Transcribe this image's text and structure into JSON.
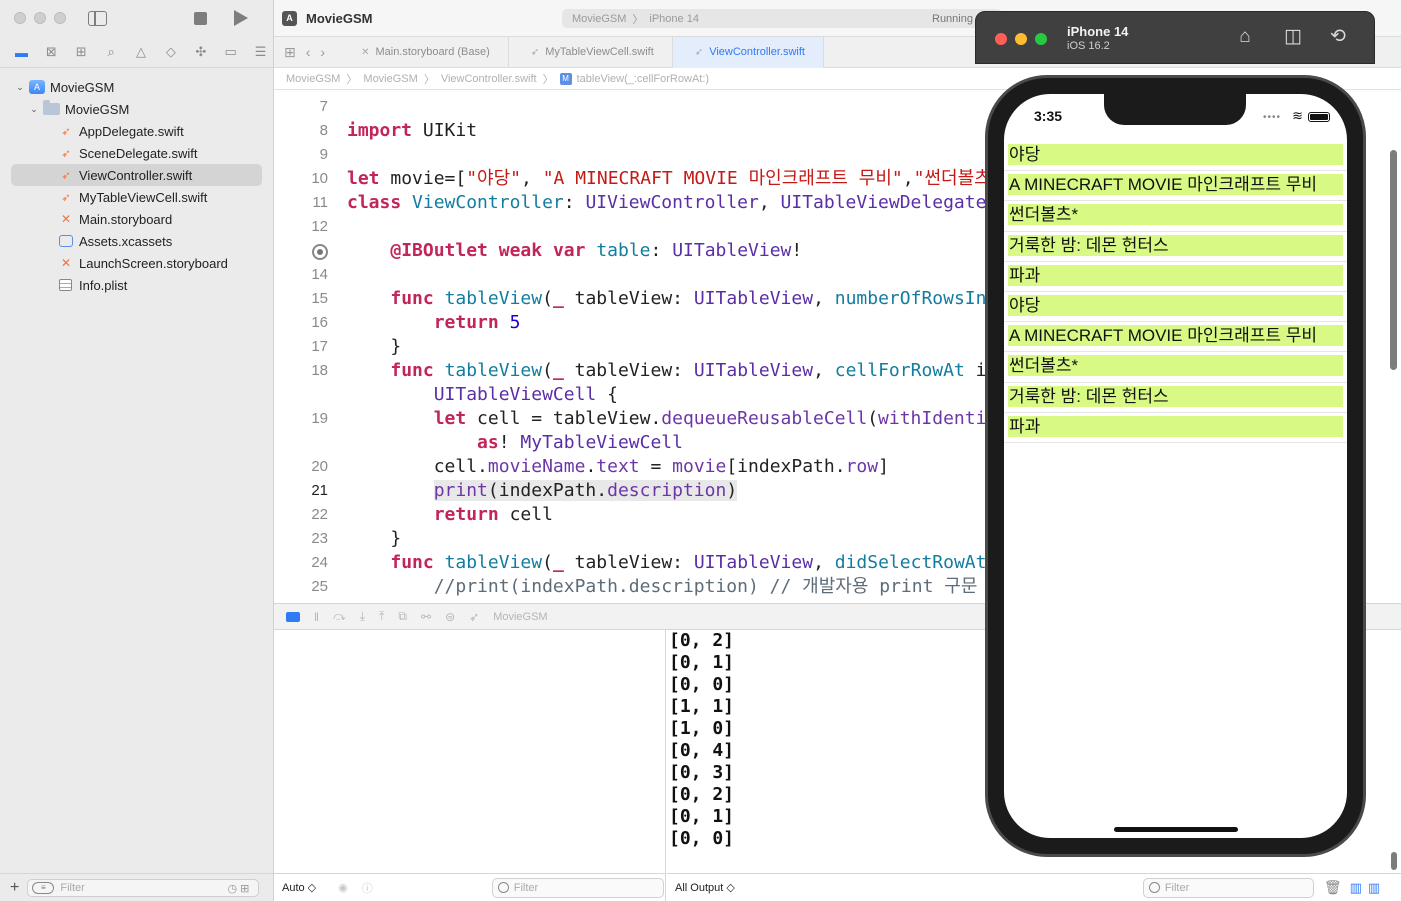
{
  "toolbar": {
    "app_title": "MovieGSM",
    "scheme_project": "MovieGSM",
    "scheme_device": "iPhone 14",
    "status": "Running"
  },
  "navigator": {
    "root": "MovieGSM",
    "group": "MovieGSM",
    "files": [
      {
        "name": "AppDelegate.swift",
        "type": "swift"
      },
      {
        "name": "SceneDelegate.swift",
        "type": "swift"
      },
      {
        "name": "ViewController.swift",
        "type": "swift",
        "selected": true
      },
      {
        "name": "MyTableViewCell.swift",
        "type": "swift"
      },
      {
        "name": "Main.storyboard",
        "type": "storyboard"
      },
      {
        "name": "Assets.xcassets",
        "type": "assets"
      },
      {
        "name": "LaunchScreen.storyboard",
        "type": "storyboard"
      },
      {
        "name": "Info.plist",
        "type": "plist"
      }
    ],
    "filter_placeholder": "Filter"
  },
  "tabs": [
    {
      "label": "Main.storyboard (Base)",
      "active": false
    },
    {
      "label": "MyTableViewCell.swift",
      "active": false
    },
    {
      "label": "ViewController.swift",
      "active": true
    }
  ],
  "jumpbar": {
    "items": [
      "MovieGSM",
      "MovieGSM",
      "ViewController.swift",
      "tableView(_:cellForRowAt:)"
    ]
  },
  "code": {
    "current_line": "21",
    "lines": [
      {
        "n": "7",
        "html": ""
      },
      {
        "n": "8",
        "html": "<span class='kw'>import</span> UIKit"
      },
      {
        "n": "9",
        "html": ""
      },
      {
        "n": "10",
        "html": "<span class='kw'>let</span> movie=[<span class='st'>\"야당\"</span>, <span class='st'>\"A MINECRAFT MOVIE 마인크래프트 무비\"</span>,<span class='st'>\"썬더볼츠*\"</span>,<span class='st'>\"거룩한 밤: 데몬 헌터스\"</span>,<span class='st'>\"파과\"</span>]"
      },
      {
        "n": "11",
        "html": "<span class='kw'>class</span> <span class='fn'>ViewController</span>: <span class='tp'>UIViewController</span>, <span class='tp'>UITableViewDelegate</span>, <span class='tp'>UITableViewDataSource</span> {"
      },
      {
        "n": "12",
        "html": ""
      },
      {
        "n": "",
        "html": "    <span class='kw'>@IBOutlet</span> <span class='kw'>weak</span> <span class='kw'>var</span> <span class='fn'>table</span>: <span class='tp'>UITableView</span>!"
      },
      {
        "n": "14",
        "html": ""
      },
      {
        "n": "15",
        "html": "    <span class='kw'>func</span> <span class='fn'>tableView</span>(<span class='kw'>_</span> tableView: <span class='tp'>UITableView</span>, <span class='fn'>numberOfRowsInSection</span> section: <span class='tp'>Int</span>) -&gt; <span class='tp'>Int</span> {"
      },
      {
        "n": "16",
        "html": "        <span class='kw'>return</span> <span class='nm'>5</span>"
      },
      {
        "n": "17",
        "html": "    }"
      },
      {
        "n": "18",
        "html": "    <span class='kw'>func</span> <span class='fn'>tableView</span>(<span class='kw'>_</span> tableView: <span class='tp'>UITableView</span>, <span class='fn'>cellForRowAt</span> indexPath: <span class='tp'>IndexPath</span>) -&gt;"
      },
      {
        "n": "",
        "html": "        <span class='tp'>UITableViewCell</span> {"
      },
      {
        "n": "19",
        "html": "        <span class='kw'>let</span> cell = tableView.<span class='ms'>dequeueReusableCell</span>(<span class='ms'>withIdentifier</span>: <span class='st'>\"myCell\"</span>, <span class='ms'>for</span>: indexPath)"
      },
      {
        "n": "",
        "html": "            <span class='kw'>as</span>! <span class='tp'>MyTableViewCell</span>"
      },
      {
        "n": "20",
        "html": "        cell.<span class='ms'>movieName</span>.<span class='ms'>text</span> = <span class='ms'>movie</span>[indexPath.<span class='ms'>row</span>]"
      },
      {
        "n": "21",
        "html": "        <span class='hl'><span class='ms'>print</span>(indexPath.<span class='ms'>description</span>)</span>"
      },
      {
        "n": "22",
        "html": "        <span class='kw'>return</span> cell"
      },
      {
        "n": "23",
        "html": "    }"
      },
      {
        "n": "24",
        "html": "    <span class='kw'>func</span> <span class='fn'>tableView</span>(<span class='kw'>_</span> tableView: <span class='tp'>UITableView</span>, <span class='fn'>didSelectRowAt</span> indexPath: <span class='tp'>IndexPath</span>) {"
      },
      {
        "n": "25",
        "html": "        <span class='cm'>//print(indexPath.description) // 개발자용 print 구문</span>"
      }
    ]
  },
  "debug": {
    "target": "MovieGSM",
    "auto_label": "Auto ◇",
    "vars_filter_placeholder": "Filter",
    "output_label": "All Output ◇",
    "console_filter_placeholder": "Filter"
  },
  "console": {
    "lines": [
      "[0, 2]",
      "[0, 1]",
      "[0, 0]",
      "[1, 1]",
      "[1, 0]",
      "[0, 4]",
      "[0, 3]",
      "[0, 2]",
      "[0, 1]",
      "[0, 0]"
    ]
  },
  "simulator": {
    "device_name": "iPhone 14",
    "ios_version": "iOS 16.2",
    "time": "3:35",
    "cell_color": "#d8f983",
    "rows": [
      "야당",
      "A MINECRAFT MOVIE 마인크래프트 무비",
      "썬더볼츠*",
      "거룩한 밤: 데몬 헌터스",
      "파과",
      "야당",
      "A MINECRAFT MOVIE 마인크래프트 무비",
      "썬더볼츠*",
      "거룩한 밤: 데몬 헌터스",
      "파과"
    ]
  }
}
